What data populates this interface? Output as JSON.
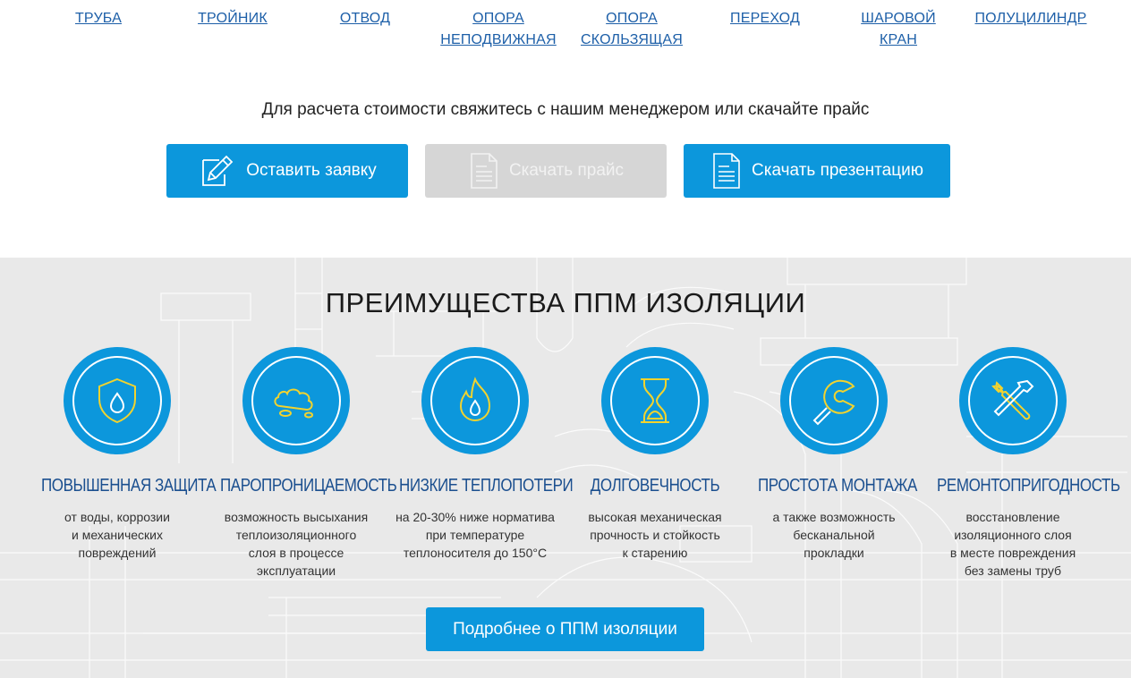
{
  "nav": [
    {
      "label": "ТРУБА"
    },
    {
      "label": "ТРОЙНИК"
    },
    {
      "label": "ОТВОД"
    },
    {
      "label": "ОПОРА НЕПОДВИЖНАЯ",
      "line1": "ОПОРА",
      "line2": "НЕПОДВИЖНАЯ"
    },
    {
      "label": "ОПОРА СКОЛЬЗЯЩАЯ",
      "line1": "ОПОРА",
      "line2": "СКОЛЬЗЯЩАЯ"
    },
    {
      "label": "ПЕРЕХОД"
    },
    {
      "label": "ШАРОВОЙ КРАН",
      "line1": "ШАРОВОЙ",
      "line2": "КРАН"
    },
    {
      "label": "ПОЛУЦИЛИНДР"
    }
  ],
  "cta": {
    "text": "Для расчета стоимости свяжитесь с нашим менеджером или скачайте прайс",
    "request_label": "Оставить заявку",
    "price_label": "Скачать прайс",
    "presentation_label": "Скачать презентацию"
  },
  "advantages": {
    "title": "ПРЕИМУЩЕСТВА ППМ ИЗОЛЯЦИИ",
    "items": [
      {
        "icon": "shield-drop-icon",
        "title": "ПОВЫШЕННАЯ ЗАЩИТА",
        "desc": [
          "от воды, коррозии",
          "и механических",
          "повреждений"
        ]
      },
      {
        "icon": "cloud-icon",
        "title": "ПАРОПРОНИЦАЕМОСТЬ",
        "desc": [
          "возможность высыхания",
          "теплоизоляционного",
          "слоя в процессе",
          "эксплуатации"
        ]
      },
      {
        "icon": "flame-drop-icon",
        "title": "НИЗКИЕ ТЕПЛОПОТЕРИ",
        "desc": [
          "на 20-30% ниже норматива",
          "при температуре",
          "теплоносителя до 150°С"
        ]
      },
      {
        "icon": "hourglass-icon",
        "title": "ДОЛГОВЕЧНОСТЬ",
        "desc": [
          "высокая механическая",
          "прочность и стойкость",
          "к старению"
        ]
      },
      {
        "icon": "wrench-icon",
        "title": "ПРОСТОТА МОНТАЖА",
        "desc": [
          "а также возможность",
          "бесканальной",
          "прокладки"
        ]
      },
      {
        "icon": "tools-icon",
        "title": "РЕМОНТОПРИГОДНОСТЬ",
        "desc": [
          "восстановление",
          "изоляционного слоя",
          "в месте повреждения",
          "без замены труб"
        ]
      }
    ],
    "more_label": "Подробнее о ППМ изоляции"
  },
  "colors": {
    "accent": "#0c97dc",
    "icon_line": "#f2d32e",
    "title_blue": "#1b4f8f",
    "link": "#1d5fa8"
  }
}
